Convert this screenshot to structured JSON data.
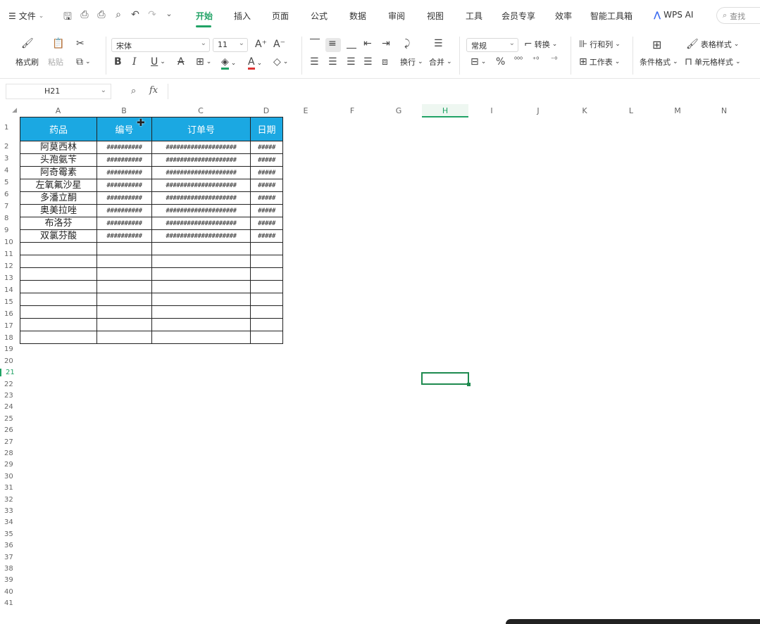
{
  "tabs_bar": {
    "file_menu": "文件",
    "tabs": [
      {
        "label": "开始",
        "active": true
      },
      {
        "label": "插入"
      },
      {
        "label": "页面"
      },
      {
        "label": "公式"
      },
      {
        "label": "数据"
      },
      {
        "label": "审阅"
      },
      {
        "label": "视图"
      },
      {
        "label": "工具"
      },
      {
        "label": "会员专享"
      },
      {
        "label": "效率"
      },
      {
        "label": "智能工具箱"
      }
    ],
    "wps_ai": "WPS AI",
    "search_placeholder": "查找"
  },
  "ribbon": {
    "format_painter": "格式刷",
    "paste": "粘贴",
    "font_name": "宋体",
    "font_size": "11",
    "wrap_text": "换行",
    "merge": "合并",
    "number_format": "常规",
    "convert": "转换",
    "rows_cols": "行和列",
    "worksheet": "工作表",
    "conditional_format": "条件格式",
    "table_style": "表格样式",
    "cell_style": "单元格样式"
  },
  "formula_bar": {
    "name_box": "H21",
    "fx": "fx",
    "formula": ""
  },
  "grid": {
    "columns": [
      "A",
      "B",
      "C",
      "D",
      "E",
      "F",
      "G",
      "H",
      "I",
      "J",
      "K",
      "L",
      "M",
      "N"
    ],
    "selected_column": "H",
    "selected_row": "21",
    "row_numbers": [
      "1",
      "2",
      "3",
      "4",
      "5",
      "6",
      "7",
      "8",
      "9",
      "10",
      "11",
      "12",
      "13",
      "14",
      "15",
      "16",
      "17",
      "18",
      "19",
      "20",
      "21",
      "22",
      "23",
      "24",
      "25",
      "26",
      "27",
      "28",
      "29",
      "30",
      "31",
      "32",
      "33",
      "34",
      "35",
      "36",
      "37",
      "38",
      "39",
      "40",
      "41"
    ]
  },
  "table": {
    "headers": [
      "药品",
      "编号",
      "订单号",
      "日期"
    ],
    "rows": [
      [
        "阿莫西林",
        "##########",
        "####################",
        "#####"
      ],
      [
        "头孢氨苄",
        "##########",
        "####################",
        "#####"
      ],
      [
        "阿奇霉素",
        "##########",
        "####################",
        "#####"
      ],
      [
        "左氧氟沙星",
        "##########",
        "####################",
        "#####"
      ],
      [
        "多潘立酮",
        "##########",
        "####################",
        "#####"
      ],
      [
        "奥美拉唑",
        "##########",
        "####################",
        "#####"
      ],
      [
        "布洛芬",
        "##########",
        "####################",
        "#####"
      ],
      [
        "双氯芬酸",
        "##########",
        "####################",
        "#####"
      ]
    ],
    "empty_row_count": 8
  },
  "colors": {
    "accent": "#21a366",
    "header_fill": "#1ba8e2",
    "header_text": "#ffffff"
  }
}
